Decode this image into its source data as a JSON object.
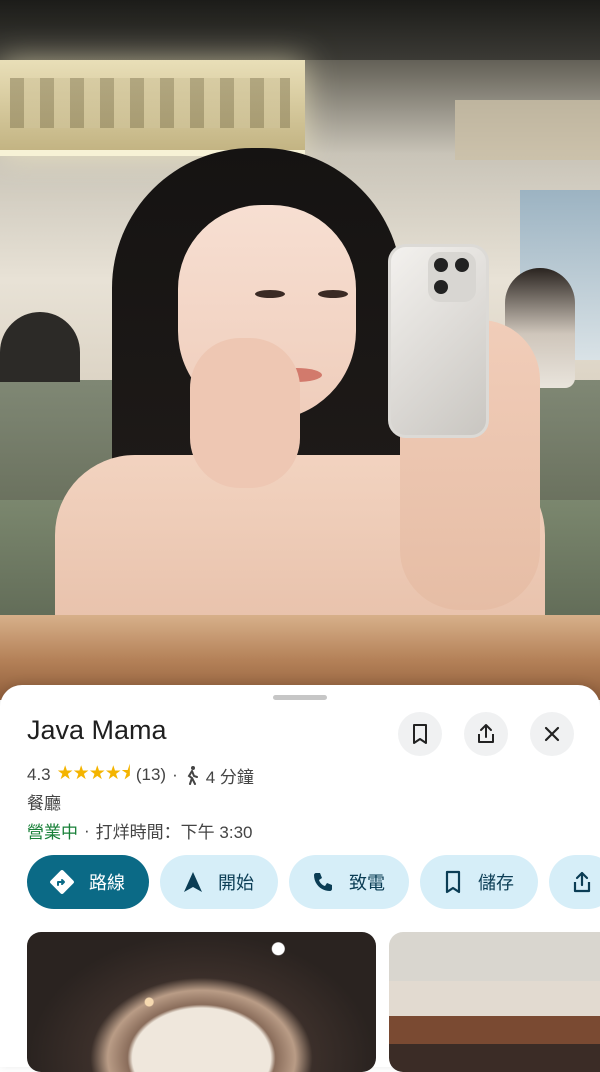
{
  "place": {
    "name": "Java Mama",
    "rating": "4.3",
    "stars_display": "★★★★⯨",
    "review_count": "(13)",
    "separator": "·",
    "walk_time": "4 分鐘",
    "category": "餐廳",
    "status": "營業中",
    "status_separator": "·",
    "closing_text": "打烊時間：下午 3:30"
  },
  "actions": {
    "directions": "路線",
    "start": "開始",
    "call": "致電",
    "save": "儲存"
  },
  "colors": {
    "primary": "#0b6a86",
    "pill_bg": "#d6eef8",
    "open_green": "#188038",
    "star": "#f4b400"
  },
  "icons": [
    "bookmark-icon",
    "share-icon",
    "close-icon",
    "walking-icon",
    "directions-icon",
    "navigate-arrow-icon",
    "phone-icon",
    "bookmark-icon",
    "share-icon"
  ]
}
